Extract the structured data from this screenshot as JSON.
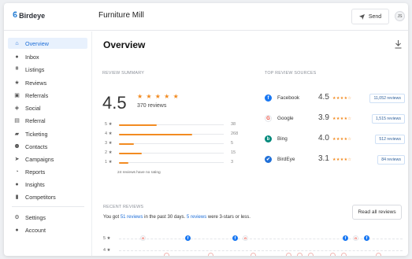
{
  "brand": {
    "name": "Birdeye"
  },
  "topbar": {
    "business_name": "Furniture Mill",
    "send_label": "Send",
    "avatar_initials": "JS"
  },
  "sidebar": {
    "items": [
      {
        "label": "Overview",
        "icon": "home-icon",
        "active": true
      },
      {
        "label": "Inbox",
        "icon": "chat-bubble-icon"
      },
      {
        "label": "Listings",
        "icon": "listings-icon"
      },
      {
        "label": "Reviews",
        "icon": "star-icon"
      },
      {
        "label": "Referrals",
        "icon": "referrals-icon"
      },
      {
        "label": "Social",
        "icon": "social-icon"
      },
      {
        "label": "Referral",
        "icon": "referral-icon"
      },
      {
        "label": "Ticketing",
        "icon": "ticket-icon"
      },
      {
        "label": "Contacts",
        "icon": "contacts-icon"
      },
      {
        "label": "Campaigns",
        "icon": "campaign-icon"
      },
      {
        "label": "Reports",
        "icon": "reports-icon"
      },
      {
        "label": "Insights",
        "icon": "insights-icon"
      },
      {
        "label": "Competitors",
        "icon": "competitors-icon"
      }
    ],
    "bottom_items": [
      {
        "label": "Settings",
        "icon": "gear-icon"
      },
      {
        "label": "Account",
        "icon": "user-icon"
      }
    ]
  },
  "main": {
    "title": "Overview",
    "review_summary": {
      "label": "REVIEW SUMMARY",
      "score": "4.5",
      "stars": "★ ★ ★ ★ ★",
      "total": "370 reviews",
      "distribution": [
        {
          "stars": "5 ★",
          "count": "38",
          "fill": 0.36
        },
        {
          "stars": "4 ★",
          "count": "268",
          "fill": 0.7
        },
        {
          "stars": "3 ★",
          "count": "5",
          "fill": 0.14
        },
        {
          "stars": "2 ★",
          "count": "15",
          "fill": 0.22
        },
        {
          "stars": "1 ★",
          "count": "3",
          "fill": 0.09
        }
      ],
      "no_rating_note": "24 reviews have no rating"
    },
    "top_sources": {
      "label": "TOP REVIEW SOURCES",
      "items": [
        {
          "name": "Facebook",
          "rating": "4.5",
          "stars": "★★★★☆",
          "count": "11,052 reviews",
          "icon": "facebook-icon",
          "color": "#1877f2",
          "glyph": "f"
        },
        {
          "name": "Google",
          "rating": "3.9",
          "stars": "★★★★☆",
          "count": "1,515 reviews",
          "icon": "google-icon",
          "color": "#ffffff",
          "glyph": "G"
        },
        {
          "name": "Bing",
          "rating": "4.0",
          "stars": "★★★★☆",
          "count": "512 reviews",
          "icon": "bing-icon",
          "color": "#00897b",
          "glyph": "b"
        },
        {
          "name": "BirdEye",
          "rating": "3.1",
          "stars": "★★★★☆",
          "count": "84 reviews",
          "icon": "birdeye-icon",
          "color": "#1f6fd8",
          "glyph": "✔"
        }
      ]
    },
    "recent_reviews": {
      "label": "RECENT REVIEWS",
      "text_prefix": "You got ",
      "count_link": "51 reviews",
      "text_middle": " in the past 30 days. ",
      "stars_link": "5 reviews",
      "text_suffix": " were 3-stars or less.",
      "read_all_label": "Read all reviews",
      "rows": [
        {
          "label": "5 ★"
        },
        {
          "label": "4 ★"
        }
      ]
    }
  }
}
